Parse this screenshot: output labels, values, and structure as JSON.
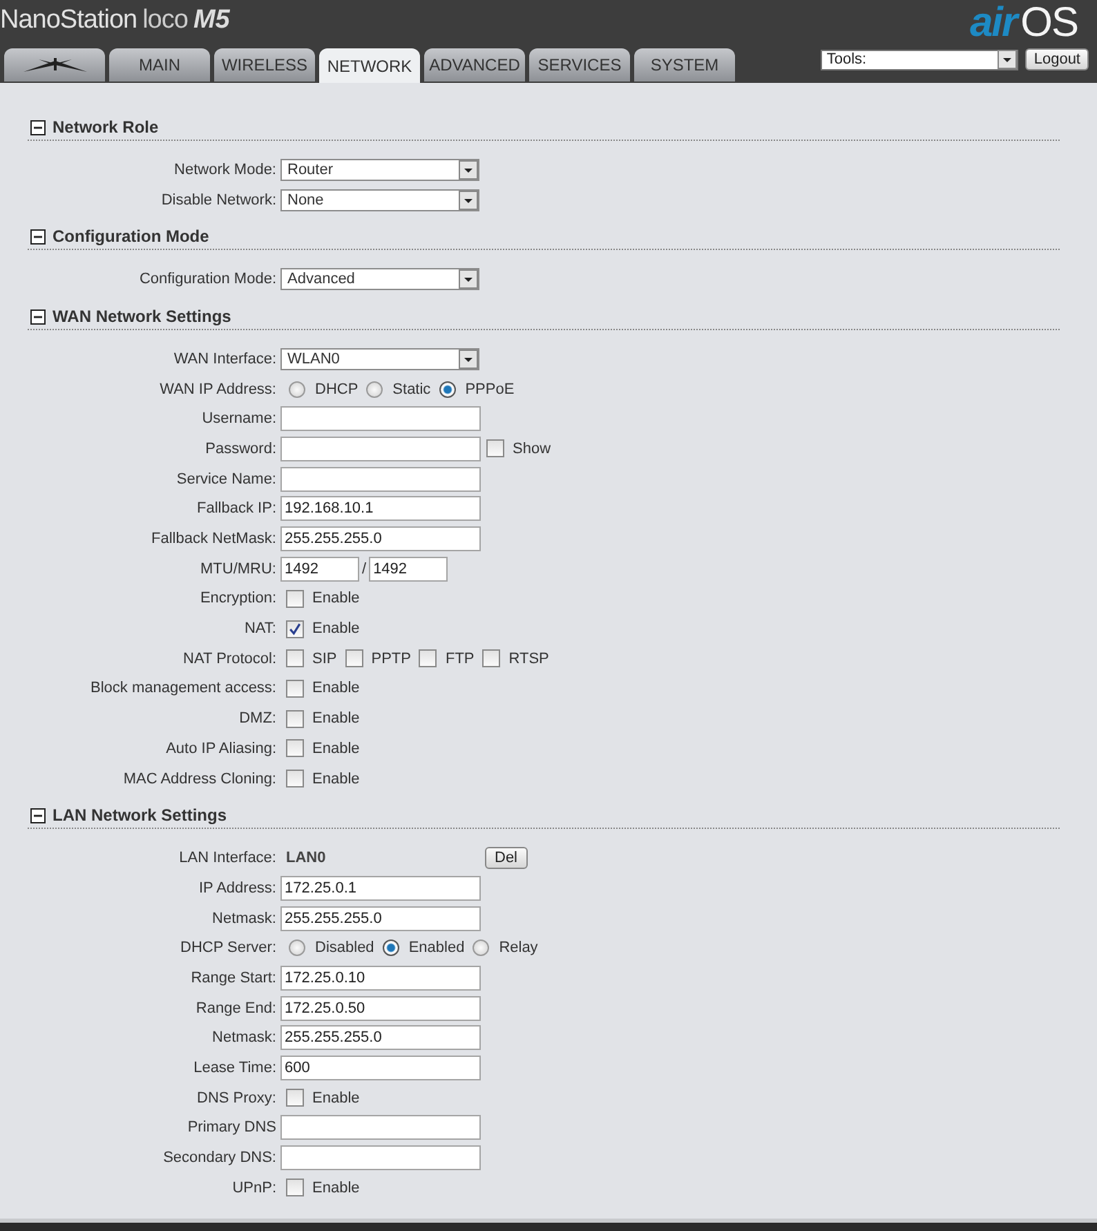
{
  "header": {
    "product": "NanoStation",
    "model": "loco",
    "variant": "M5",
    "logo_air": "air",
    "logo_os": "OS"
  },
  "tabs": [
    {
      "kind": "icon",
      "selected": false
    },
    {
      "label": "MAIN",
      "selected": false
    },
    {
      "label": "WIRELESS",
      "selected": false
    },
    {
      "label": "NETWORK",
      "selected": true
    },
    {
      "label": "ADVANCED",
      "selected": false
    },
    {
      "label": "SERVICES",
      "selected": false
    },
    {
      "label": "SYSTEM",
      "selected": false
    }
  ],
  "tools": {
    "value": "Tools:"
  },
  "logout": "Logout",
  "sections": [
    {
      "title": "Network Role",
      "expanded": true,
      "rows": [
        {
          "label": "Network Mode:",
          "kind": "select",
          "value": "Router"
        },
        {
          "label": "Disable Network:",
          "kind": "select",
          "value": "None"
        }
      ]
    },
    {
      "title": "Configuration Mode",
      "expanded": true,
      "rows": [
        {
          "label": "Configuration Mode:",
          "kind": "select",
          "value": "Advanced"
        }
      ]
    },
    {
      "title": "WAN Network Settings",
      "expanded": true,
      "rows": [
        {
          "label": "WAN Interface:",
          "kind": "select",
          "value": "WLAN0"
        },
        {
          "label": "WAN IP Address:",
          "kind": "radio",
          "options": [
            {
              "label": "DHCP",
              "selected": false
            },
            {
              "label": "Static",
              "selected": false
            },
            {
              "label": "PPPoE",
              "selected": true
            }
          ]
        },
        {
          "label": "Username:",
          "kind": "text"
        },
        {
          "label": "Password:",
          "kind": "text",
          "toggle": {
            "label": "Show",
            "checked": false
          }
        },
        {
          "label": "Service Name:",
          "kind": "text"
        },
        {
          "label": "Fallback IP:",
          "kind": "text",
          "value": "192.168.10.1"
        },
        {
          "label": "Fallback NetMask:",
          "kind": "text",
          "value": "255.255.255.0"
        },
        {
          "label": "MTU/MRU:",
          "kind": "pair",
          "values": [
            "1492",
            "1492"
          ],
          "separator": "/"
        },
        {
          "label": "Encryption:",
          "kind": "checks",
          "options": [
            {
              "label": "Enable",
              "checked": false
            }
          ]
        },
        {
          "label": "NAT:",
          "kind": "checks",
          "options": [
            {
              "label": "Enable",
              "checked": true
            }
          ]
        },
        {
          "label": "NAT Protocol:",
          "kind": "checks",
          "options": [
            {
              "label": "SIP",
              "checked": false
            },
            {
              "label": "PPTP",
              "checked": false
            },
            {
              "label": "FTP",
              "checked": false
            },
            {
              "label": "RTSP",
              "checked": false
            }
          ]
        },
        {
          "label": "Block management access:",
          "kind": "checks",
          "options": [
            {
              "label": "Enable",
              "checked": false
            }
          ]
        },
        {
          "label": "DMZ:",
          "kind": "checks",
          "options": [
            {
              "label": "Enable",
              "checked": false
            }
          ]
        },
        {
          "label": "Auto IP Aliasing:",
          "kind": "checks",
          "options": [
            {
              "label": "Enable",
              "checked": false
            }
          ]
        },
        {
          "label": "MAC Address Cloning:",
          "kind": "checks",
          "options": [
            {
              "label": "Enable",
              "checked": false
            }
          ]
        }
      ]
    },
    {
      "title": "LAN Network Settings",
      "expanded": true,
      "rows": [
        {
          "label": "LAN Interface:",
          "kind": "static",
          "value": "LAN0",
          "button": "Del"
        },
        {
          "label": "IP Address:",
          "kind": "text",
          "value": "172.25.0.1"
        },
        {
          "label": "Netmask:",
          "kind": "text",
          "value": "255.255.255.0"
        },
        {
          "label": "DHCP Server:",
          "kind": "radio",
          "options": [
            {
              "label": "Disabled",
              "selected": false
            },
            {
              "label": "Enabled",
              "selected": true
            },
            {
              "label": "Relay",
              "selected": false
            }
          ]
        },
        {
          "label": "Range Start:",
          "kind": "text",
          "value": "172.25.0.10"
        },
        {
          "label": "Range End:",
          "kind": "text",
          "value": "172.25.0.50"
        },
        {
          "label": "Netmask:",
          "kind": "text",
          "value": "255.255.255.0"
        },
        {
          "label": "Lease Time:",
          "kind": "text",
          "value": "600"
        },
        {
          "label": "DNS Proxy:",
          "kind": "checks",
          "options": [
            {
              "label": "Enable",
              "checked": false
            }
          ]
        },
        {
          "label": "Primary DNS",
          "kind": "text"
        },
        {
          "label": "Secondary DNS:",
          "kind": "text"
        },
        {
          "label": "UPnP:",
          "kind": "checks",
          "options": [
            {
              "label": "Enable",
              "checked": false
            }
          ]
        }
      ]
    }
  ]
}
